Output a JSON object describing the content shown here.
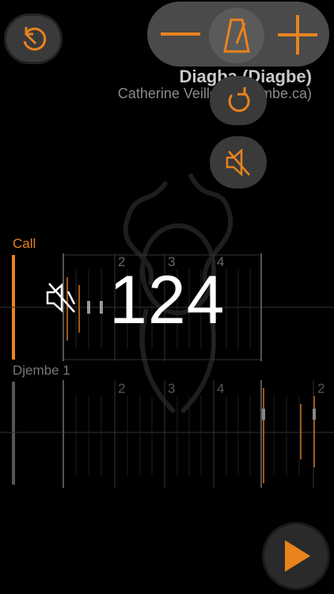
{
  "song": {
    "title": "Diagba (Diagbe)",
    "author": "Catherine Veilleux (djembe.ca)"
  },
  "tempo": {
    "value": "124"
  },
  "tracks": [
    {
      "name": "Call",
      "beats": [
        "2",
        "3",
        "4"
      ]
    },
    {
      "name": "Djembe 1",
      "beats": [
        "2",
        "3",
        "4",
        "2"
      ]
    }
  ],
  "colors": {
    "accent": "#e8831e",
    "button_bg": "#3a3a3a",
    "pill_bg": "#4a4a4a",
    "title": "#c8c8c8",
    "subtitle": "#8a8a8a"
  },
  "icons": {
    "reset": "reset-icon",
    "minus": "minus-icon",
    "plus": "plus-icon",
    "metronome": "metronome-icon",
    "mute": "mute-icon",
    "play": "play-icon"
  }
}
